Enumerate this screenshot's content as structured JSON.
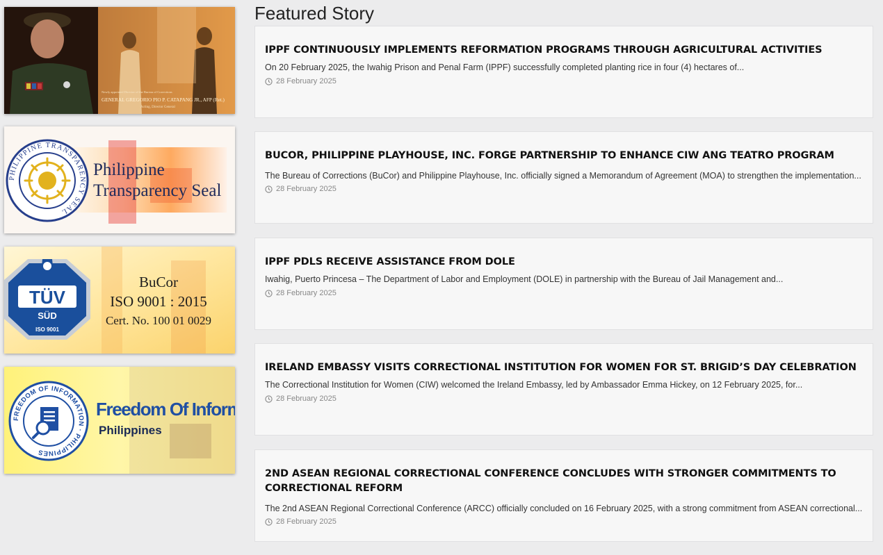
{
  "banners": [
    {
      "id": "director-general",
      "caption_small": "Newly appointed Director of the Bureau of Corrections",
      "caption_name": "GENERAL GREGORIO PIO P. CATAPANG JR., AFP (Ret.)",
      "caption_role": "Acting, Director General"
    },
    {
      "id": "transparency-seal",
      "line1": "Philippine",
      "line2": "Transparency Seal",
      "seal_text": "PHILIPPINE TRANSPARENCY SEAL"
    },
    {
      "id": "iso",
      "badge_top": "TÜV",
      "badge_mid": "SÜD",
      "badge_bottom": "ISO 9001",
      "line1": "BuCor",
      "line2": "ISO 9001 : 2015",
      "line3": "Cert. No. 100 01 0029"
    },
    {
      "id": "foi",
      "title": "Freedom Of Information",
      "subtitle": "Philippines",
      "seal_text": "FREEDOM OF INFORMATION · PHILIPPINES"
    }
  ],
  "featured": {
    "heading": "Featured Story",
    "stories": [
      {
        "title": "IPPF CONTINUOUSLY IMPLEMENTS REFORMATION PROGRAMS THROUGH AGRICULTURAL ACTIVITIES",
        "excerpt": "On 20 February 2025, the Iwahig Prison and Penal Farm (IPPF) successfully completed planting rice in four (4) hectares of...",
        "date": "28 February 2025"
      },
      {
        "title": "BUCOR, PHILIPPINE PLAYHOUSE, INC. FORGE PARTNERSHIP TO ENHANCE CIW ANG TEATRO PROGRAM",
        "excerpt": "The Bureau of Corrections (BuCor) and Philippine Playhouse, Inc. officially signed a Memorandum of Agreement (MOA) to strengthen the implementation...",
        "date": "28 February 2025"
      },
      {
        "title": "IPPF PDLS RECEIVE ASSISTANCE FROM DOLE",
        "excerpt": " Iwahig, Puerto Princesa – The Department of Labor and Employment (DOLE) in partnership with the Bureau of Jail Management and...",
        "date": "28 February 2025"
      },
      {
        "title": "IRELAND EMBASSY VISITS CORRECTIONAL INSTITUTION FOR WOMEN FOR ST. BRIGID’S DAY CELEBRATION",
        "excerpt": "The Correctional Institution for Women (CIW) welcomed the Ireland Embassy, led by Ambassador Emma Hickey, on 12 February 2025, for...",
        "date": "28 February 2025"
      },
      {
        "title": "2ND ASEAN REGIONAL CORRECTIONAL CONFERENCE CONCLUDES WITH STRONGER COMMITMENTS TO CORRECTIONAL REFORM",
        "excerpt": "The 2nd ASEAN Regional Correctional Conference (ARCC) officially concluded on 16 February 2025, with a strong commitment from ASEAN correctional...",
        "date": "28 February 2025"
      }
    ]
  },
  "icons": {
    "date": "clock-icon"
  },
  "colors": {
    "page_bg": "#ececed",
    "card_bg": "#f7f7f7",
    "title": "#111111",
    "date": "#888888",
    "tuv_blue": "#1a4f9c",
    "foi_blue": "#1f4fa3",
    "seal_gold": "#e2b21d"
  }
}
